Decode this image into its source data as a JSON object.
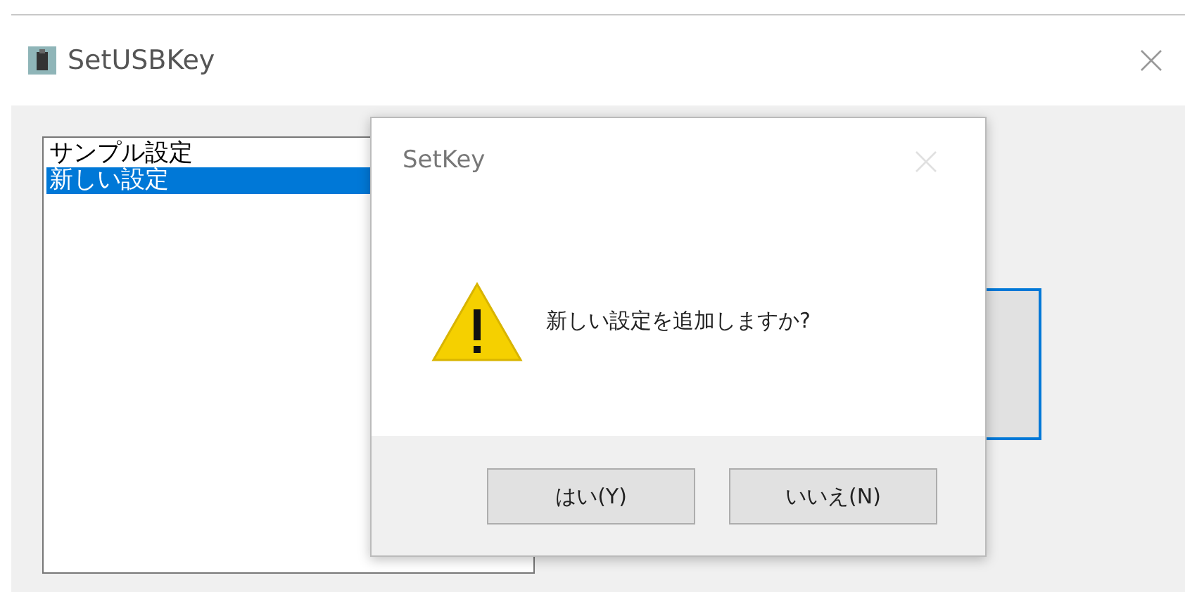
{
  "window": {
    "title": "SetUSBKey"
  },
  "settings_list": [
    {
      "label": "サンプル設定",
      "selected": false
    },
    {
      "label": "新しい設定",
      "selected": true
    }
  ],
  "dialog": {
    "title": "SetKey",
    "kind": "warning",
    "message": "新しい設定を追加しますか?",
    "close_disabled": true,
    "buttons": [
      {
        "label": "はい(Y)"
      },
      {
        "label": "いいえ(N)"
      }
    ]
  }
}
